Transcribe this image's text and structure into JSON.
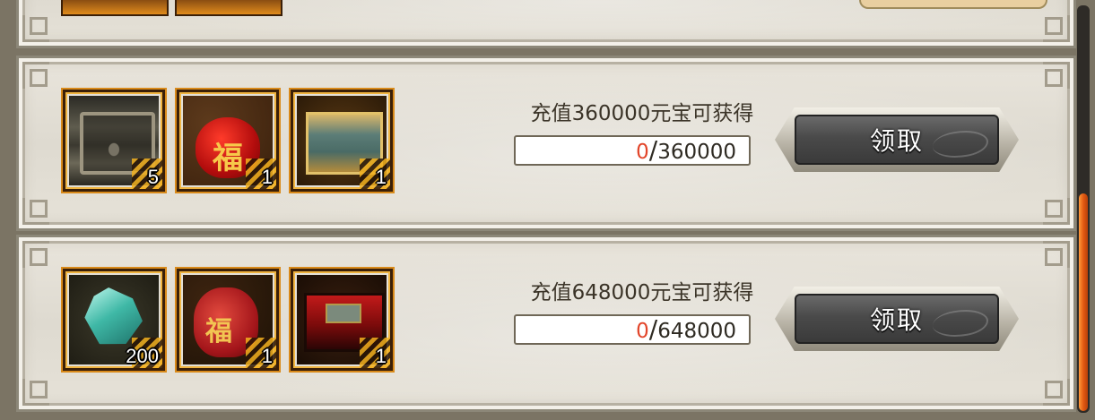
{
  "rows": [
    {
      "goal": "充值360000元宝可获得",
      "progress": {
        "current": "0",
        "sep": "/",
        "target": "360000"
      },
      "claim_label": "领取",
      "items": [
        {
          "icon": "dark-treasure-chest-icon",
          "qty": "5"
        },
        {
          "icon": "red-lucky-bag-icon",
          "qty": "1"
        },
        {
          "icon": "ornate-jade-chest-icon",
          "qty": "1"
        }
      ]
    },
    {
      "goal": "充值648000元宝可获得",
      "progress": {
        "current": "0",
        "sep": "/",
        "target": "648000"
      },
      "claim_label": "领取",
      "items": [
        {
          "icon": "jade-crystal-icon",
          "qty": "200"
        },
        {
          "icon": "fu-gift-bag-icon",
          "qty": "1"
        },
        {
          "icon": "red-lacquer-chest-icon",
          "qty": "1"
        }
      ]
    }
  ],
  "colors": {
    "progress_current": "#e2452a",
    "scroll_thumb": "#e25a12"
  }
}
